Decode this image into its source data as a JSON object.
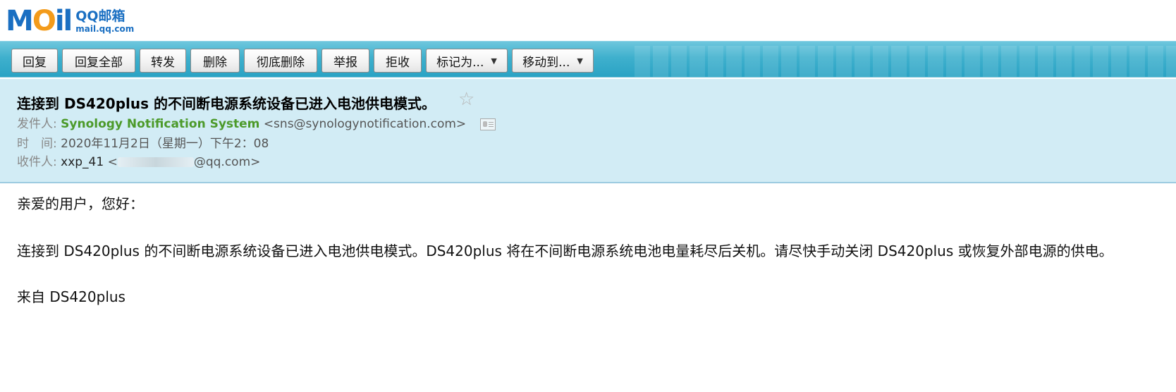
{
  "logo": {
    "mark": "MOil",
    "name": "QQ邮箱",
    "url": "mail.qq.com"
  },
  "toolbar": {
    "buttons": [
      "回复",
      "回复全部",
      "转发",
      "删除",
      "彻底删除",
      "举报",
      "拒收",
      "标记为...",
      "移动到..."
    ]
  },
  "mail": {
    "subject": "连接到 DS420plus 的不间断电源系统设备已进入电池供电模式。",
    "from_label": "发件人:",
    "from_name": "Synology Notification System",
    "from_address": "<sns@synologynotification.com>",
    "time_label": "时　间:",
    "time_value": "2020年11月2日（星期一）下午2：08",
    "to_label": "收件人:",
    "to_name": "xxp_41",
    "to_address_prefix": "<",
    "to_address_suffix": "@qq.com>"
  },
  "body": {
    "greeting": "亲爱的用户，您好：",
    "message": "连接到 DS420plus 的不间断电源系统设备已进入电池供电模式。DS420plus 将在不间断电源系统电池电量耗尽后关机。请尽快手动关闭 DS420plus 或恢复外部电源的供电。",
    "signature": "来自 DS420plus"
  }
}
